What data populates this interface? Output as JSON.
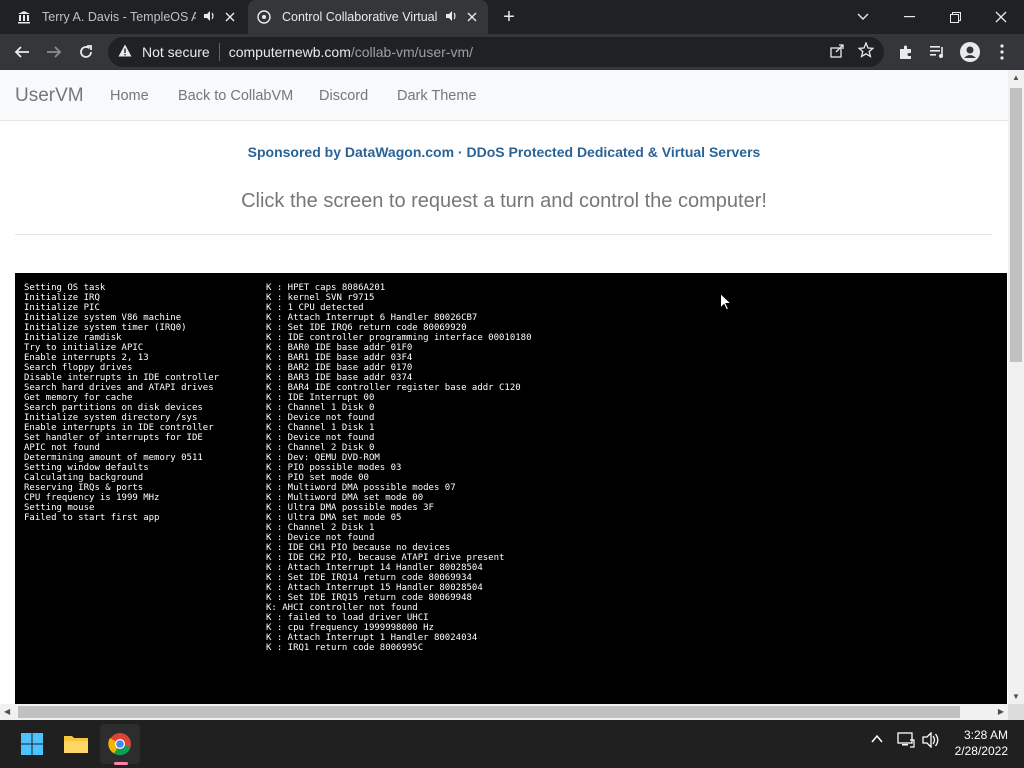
{
  "browser": {
    "tabs": [
      {
        "title": "Terry A. Davis - TempleOS Ar",
        "favicon": "bank-icon",
        "active": false
      },
      {
        "title": "Control Collaborative Virtual",
        "favicon": "plugin-icon",
        "active": true
      }
    ],
    "address": {
      "security": "Not secure",
      "host": "computernewb.com",
      "path": "/collab-vm/user-vm/"
    }
  },
  "site": {
    "brand": "UserVM",
    "nav": [
      "Home",
      "Back to CollabVM",
      "Discord",
      "Dark Theme"
    ],
    "sponsor": "Sponsored by DataWagon.com · DDoS Protected Dedicated & Virtual Servers",
    "cta": "Click the screen to request a turn and control the computer!"
  },
  "vm": {
    "left_lines": [
      "Setting OS task",
      "Initialize IRQ",
      "Initialize PIC",
      "Initialize system V86 machine",
      "Initialize system timer (IRQ0)",
      "Initialize ramdisk",
      "Try to initialize APIC",
      "Enable interrupts 2, 13",
      "Search floppy drives",
      "Disable interrupts in IDE controller",
      "Search hard drives and ATAPI drives",
      "Get memory for cache",
      "Search partitions on disk devices",
      "Initialize system directory /sys",
      "Enable interrupts in IDE controller",
      "Set handler of interrupts for IDE",
      "APIC not found",
      "Determining amount of memory 0511",
      "Setting window defaults",
      "Calculating background",
      "Reserving IRQs & ports",
      "CPU frequency is 1999 MHz",
      "Setting mouse",
      "Failed to start first app"
    ],
    "right_lines": [
      "K : HPET caps 8086A201",
      "K : kernel SVN r9715",
      "K : 1 CPU detected",
      "K : Attach Interrupt 6 Handler 80026CB7",
      "K : Set IDE IRQ6 return code 80069920",
      "K : IDE controller programming interface 00010180",
      "K : BAR0 IDE base addr 01F0",
      "K : BAR1 IDE base addr 03F4",
      "K : BAR2 IDE base addr 0170",
      "K : BAR3 IDE base addr 0374",
      "K : BAR4 IDE controller register base addr C120",
      "K : IDE Interrupt 00",
      "K : Channel 1 Disk 0",
      "K : Device not found",
      "K : Channel 1 Disk 1",
      "K : Device not found",
      "K : Channel 2 Disk 0",
      "K : Dev: QEMU DVD-ROM",
      "K : PIO possible modes 03",
      "K : PIO set mode 00",
      "K : Multiword DMA possible modes 07",
      "K : Multiword DMA set mode 00",
      "K : Ultra DMA possible modes 3F",
      "K : Ultra DMA set mode 05",
      "K : Channel 2 Disk 1",
      "K : Device not found",
      "K : IDE CH1 PIO because no devices",
      "K : IDE CH2 PIO, because ATAPI drive present",
      "K : Attach Interrupt 14 Handler 80028504",
      "K : Set IDE IRQ14 return code 80069934",
      "K : Attach Interrupt 15 Handler 80028504",
      "K : Set IDE IRQ15 return code 80069948",
      "K: AHCI controller not found",
      "K : failed to load driver UHCI",
      "K : cpu frequency 1999998000 Hz",
      "K : Attach Interrupt 1 Handler 80024034",
      "K : IRQ1 return code 8006995C"
    ]
  },
  "taskbar": {
    "time": "3:28 AM",
    "date": "2/28/2022"
  }
}
